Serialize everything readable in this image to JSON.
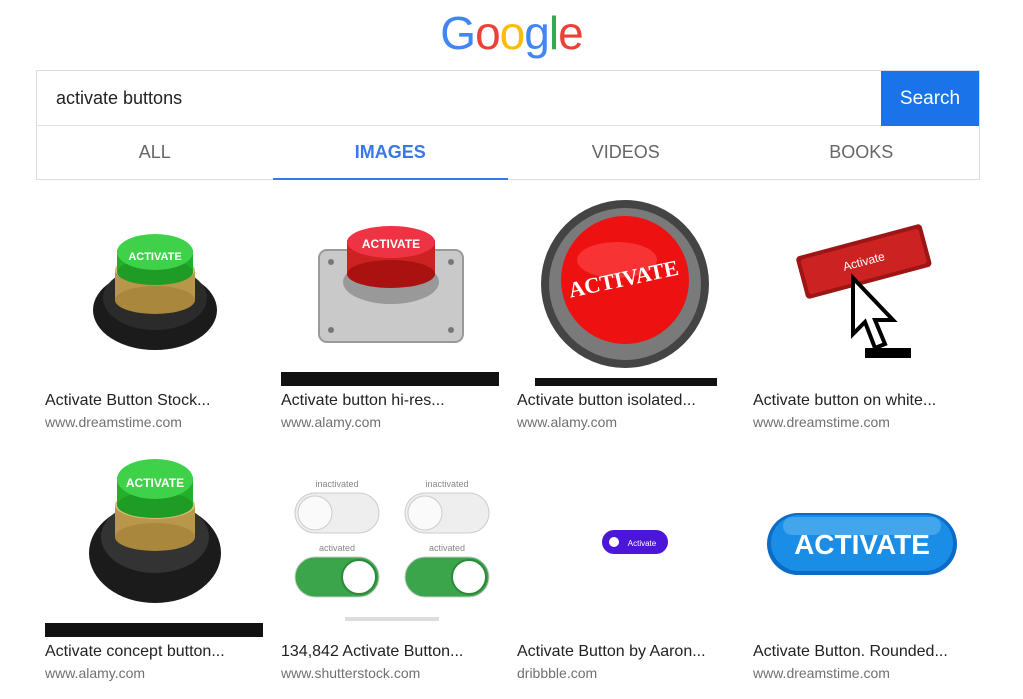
{
  "logo": {
    "letters": [
      "G",
      "o",
      "o",
      "g",
      "l",
      "e"
    ]
  },
  "search": {
    "value": "activate buttons",
    "button_label": "Search"
  },
  "tabs": [
    {
      "label": "ALL",
      "active": false
    },
    {
      "label": "IMAGES",
      "active": true
    },
    {
      "label": "VIDEOS",
      "active": false
    },
    {
      "label": "BOOKS",
      "active": false
    }
  ],
  "results": [
    {
      "title": "Activate Button Stock...",
      "site": "www.dreamstime.com",
      "image_text": "ACTIVATE"
    },
    {
      "title": "Activate button hi-res...",
      "site": "www.alamy.com",
      "image_text": "ACTIVATE"
    },
    {
      "title": "Activate button isolated...",
      "site": "www.alamy.com",
      "image_text": "ACTIVATE"
    },
    {
      "title": "Activate button on white...",
      "site": "www.dreamstime.com",
      "image_text": "Activate"
    },
    {
      "title": "Activate concept button...",
      "site": "www.alamy.com",
      "image_text": "ACTIVATE"
    },
    {
      "title": "134,842 Activate Button...",
      "site": "www.shutterstock.com",
      "image_text": [
        "inactivated",
        "inactivated",
        "activated",
        "activated"
      ]
    },
    {
      "title": "Activate Button by Aaron...",
      "site": "dribbble.com",
      "image_text": "Activate"
    },
    {
      "title": "Activate Button. Rounded...",
      "site": "www.dreamstime.com",
      "image_text": "ACTIVATE"
    }
  ],
  "colors": {
    "accent": "#1a73e8",
    "tab_active": "#3b78e7"
  }
}
